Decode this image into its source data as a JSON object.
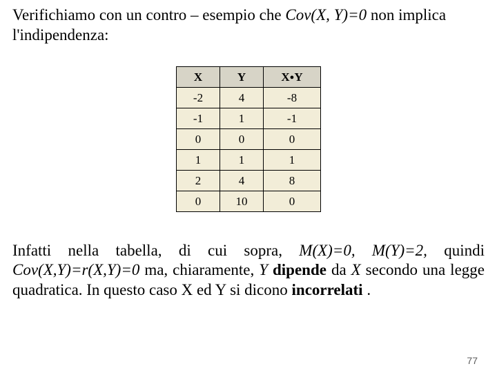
{
  "intro": {
    "lead": "Verifichiamo con un contro – esempio che ",
    "cov": "Cov(X, Y)=0",
    "tail1": " non implica l'indipendenza:"
  },
  "table": {
    "headers": {
      "x": "X",
      "y": "Y",
      "xy_pre": "X",
      "xy_post": "Y"
    },
    "rows": [
      {
        "x": "-2",
        "y": "4",
        "xy": "-8"
      },
      {
        "x": "-1",
        "y": "1",
        "xy": "-1"
      },
      {
        "x": "0",
        "y": "0",
        "xy": "0"
      },
      {
        "x": "1",
        "y": "1",
        "xy": "1"
      },
      {
        "x": "2",
        "y": "4",
        "xy": "8"
      },
      {
        "x": "0",
        "y": "10",
        "xy": "0"
      }
    ]
  },
  "outro": {
    "t1": "Infatti nella tabella, di cui sopra, ",
    "mx": "M(X)=0,",
    "sp1": " ",
    "my": "M(Y)=2,",
    "t2": " quindi ",
    "cov": "Cov(X,Y)=r(X,Y)=0",
    "t3": " ma, chiaramente, ",
    "yvar": "Y",
    "sp2": " ",
    "dep": "dipende",
    "t4": " da ",
    "xvar": "X",
    "t5": " secondo una legge quadratica. In questo caso X ed Y si dicono ",
    "inc": "incorrelati",
    "t6": " ."
  },
  "page_number": "77"
}
